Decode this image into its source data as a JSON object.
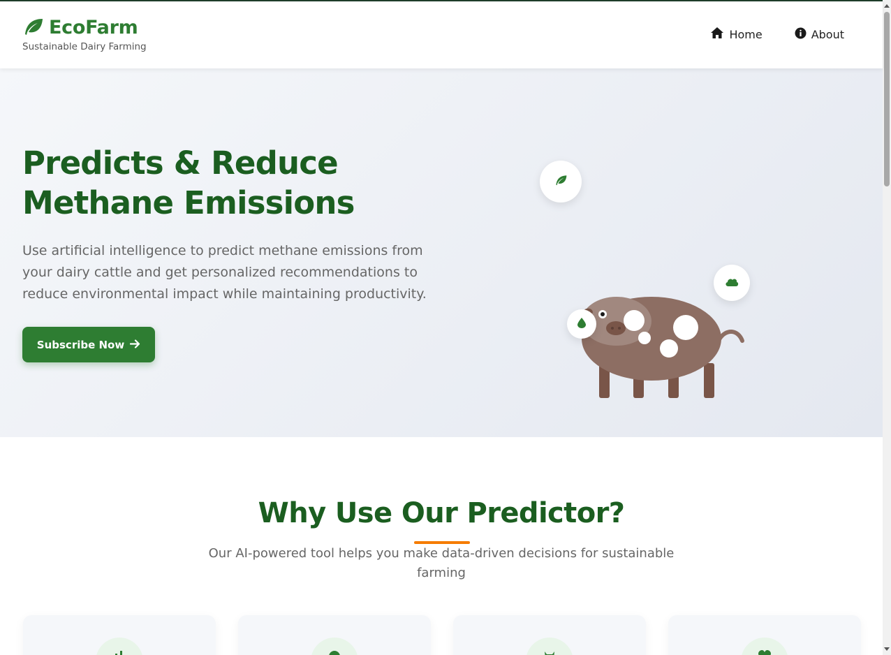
{
  "header": {
    "brand_title": "EcoFarm",
    "brand_subtitle": "Sustainable Dairy Farming",
    "nav": [
      {
        "label": "Home",
        "icon": "home-icon"
      },
      {
        "label": "About",
        "icon": "info-icon"
      }
    ]
  },
  "hero": {
    "title": "Predicts & Reduce Methane Emissions",
    "text": "Use artificial intelligence to predict methane emissions from your dairy cattle and get personalized recommendations to reduce environmental impact while maintaining productivity.",
    "cta_label": "Subscribe Now",
    "cta_icon": "arrow-right-icon",
    "float_icons": [
      "leaf-icon",
      "cloud-icon",
      "water-drop-icon"
    ]
  },
  "features": {
    "title": "Why Use Our Predictor?",
    "subtitle": "Our AI-powered tool helps you make data-driven decisions for sustainable farming",
    "cards": [
      {
        "icon": "chart-icon"
      },
      {
        "icon": "globe-icon"
      },
      {
        "icon": "cow-icon"
      },
      {
        "icon": "heart-icon"
      }
    ]
  },
  "colors": {
    "primary": "#2e7d32",
    "dark_green": "#1b5e20",
    "accent": "#f57c00",
    "cow_body": "#8d6e63",
    "cow_legs": "#795548"
  }
}
